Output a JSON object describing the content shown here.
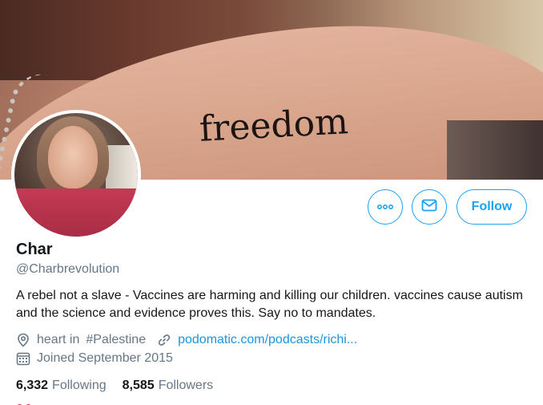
{
  "banner": {
    "tattoo_text": "freedom"
  },
  "actions": {
    "more_icon": "more-dots-icon",
    "message_icon": "envelope-icon",
    "follow_label": "Follow",
    "accent": "#1da1f2"
  },
  "profile": {
    "name": "Char",
    "handle": "@Charbrevolution",
    "bio": "A rebel not a slave - Vaccines are harming and killing our children. vaccines cause autism and the science and evidence proves this. Say no to mandates.",
    "location_prefix": "heart in",
    "location_hashtag": "#Palestine",
    "url": "podomatic.com/podcasts/richi...",
    "joined": "Joined September 2015"
  },
  "stats": {
    "following_count": "6,332",
    "following_label": "Following",
    "followers_count": "8,585",
    "followers_label": "Followers"
  }
}
